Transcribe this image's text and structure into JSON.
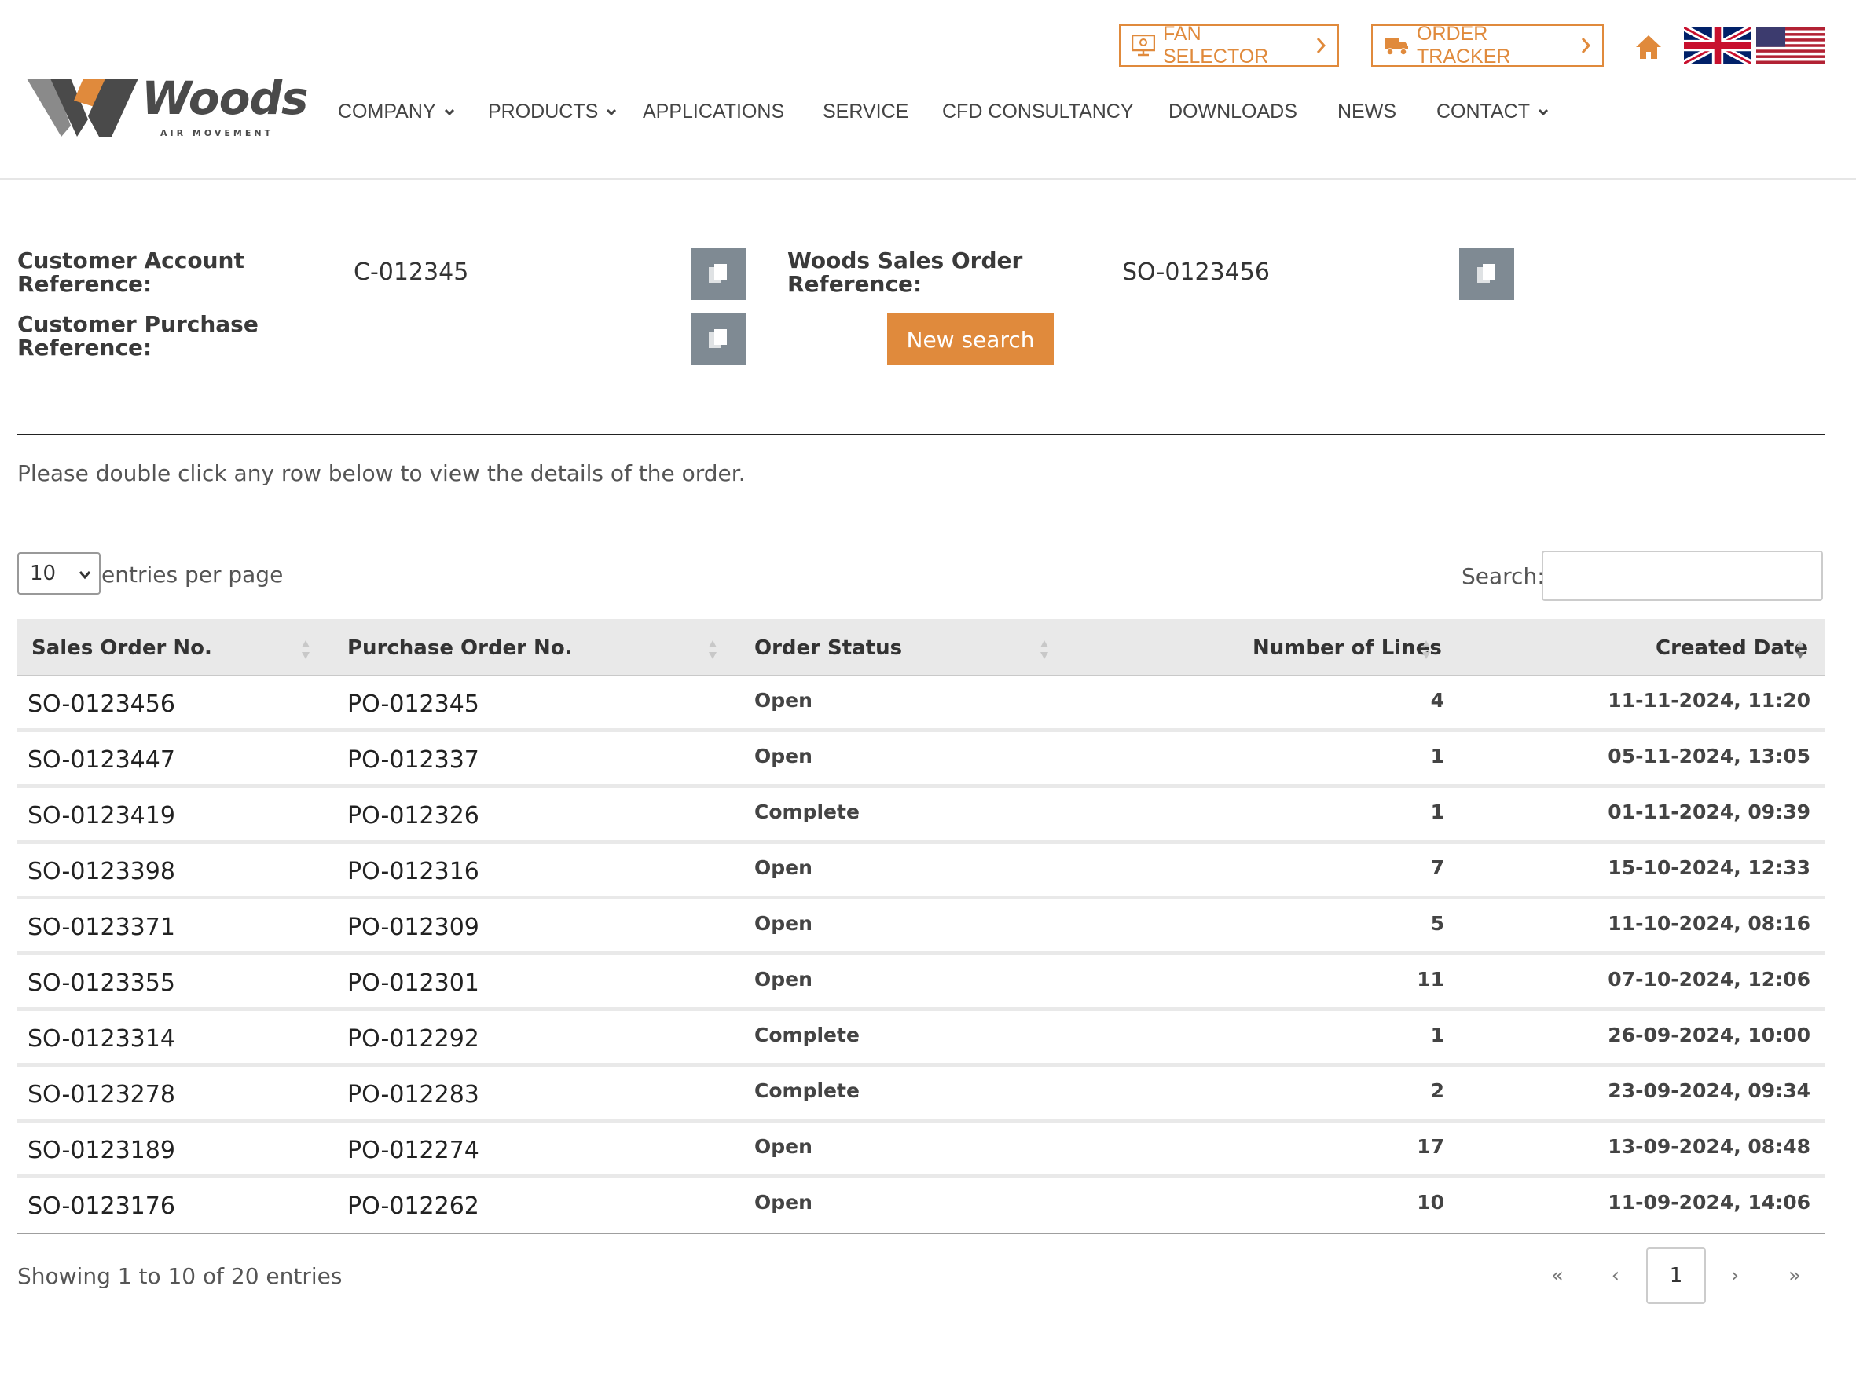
{
  "header": {
    "logo_text": "Woods",
    "logo_sub": "AIR MOVEMENT",
    "fan_selector": "FAN SELECTOR",
    "order_tracker": "ORDER TRACKER",
    "nav": [
      "COMPANY",
      "PRODUCTS",
      "APPLICATIONS",
      "SERVICE",
      "CFD CONSULTANCY",
      "DOWNLOADS",
      "NEWS",
      "CONTACT"
    ],
    "accent_color": "#e08a3c"
  },
  "info": {
    "customer_account_label": "Customer Account Reference:",
    "customer_account_value": "C-012345",
    "customer_purchase_label": "Customer Purchase Reference:",
    "customer_purchase_value": "",
    "sales_order_label": "Woods Sales Order Reference:",
    "sales_order_value": "SO-0123456",
    "new_search": "New search"
  },
  "hint": "Please double click any row below to view the details of the order.",
  "controls": {
    "entries_value": "10",
    "entries_label": "entries per page",
    "search_label": "Search:",
    "search_value": ""
  },
  "table": {
    "headers": [
      "Sales Order No.",
      "Purchase Order No.",
      "Order Status",
      "Number of Lines",
      "Created Date"
    ],
    "rows": [
      [
        "SO-0123456",
        "PO-012345",
        "Open",
        "4",
        "11-11-2024, 11:20"
      ],
      [
        "SO-0123447",
        "PO-012337",
        "Open",
        "1",
        "05-11-2024, 13:05"
      ],
      [
        "SO-0123419",
        "PO-012326",
        "Complete",
        "1",
        "01-11-2024, 09:39"
      ],
      [
        "SO-0123398",
        "PO-012316",
        "Open",
        "7",
        "15-10-2024, 12:33"
      ],
      [
        "SO-0123371",
        "PO-012309",
        "Open",
        "5",
        "11-10-2024, 08:16"
      ],
      [
        "SO-0123355",
        "PO-012301",
        "Open",
        "11",
        "07-10-2024, 12:06"
      ],
      [
        "SO-0123314",
        "PO-012292",
        "Complete",
        "1",
        "26-09-2024, 10:00"
      ],
      [
        "SO-0123278",
        "PO-012283",
        "Complete",
        "2",
        "23-09-2024, 09:34"
      ],
      [
        "SO-0123189",
        "PO-012274",
        "Open",
        "17",
        "13-09-2024, 08:48"
      ],
      [
        "SO-0123176",
        "PO-012262",
        "Open",
        "10",
        "11-09-2024, 14:06"
      ]
    ]
  },
  "footer": {
    "showing": "Showing 1 to 10 of 20 entries",
    "pagination": [
      "«",
      "‹",
      "1",
      "›",
      "»"
    ]
  }
}
